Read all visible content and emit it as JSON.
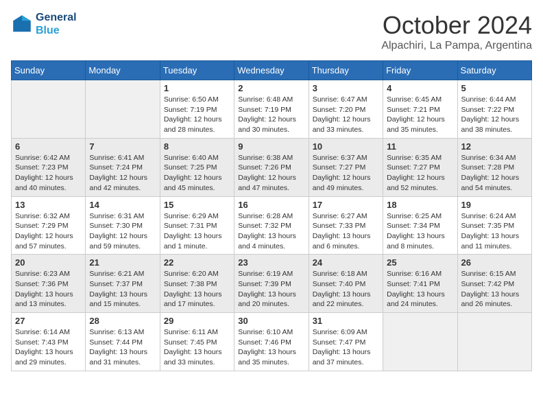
{
  "header": {
    "logo_line1": "General",
    "logo_line2": "Blue",
    "month_title": "October 2024",
    "location": "Alpachiri, La Pampa, Argentina"
  },
  "weekdays": [
    "Sunday",
    "Monday",
    "Tuesday",
    "Wednesday",
    "Thursday",
    "Friday",
    "Saturday"
  ],
  "weeks": [
    [
      {
        "day": "",
        "info": ""
      },
      {
        "day": "",
        "info": ""
      },
      {
        "day": "1",
        "info": "Sunrise: 6:50 AM\nSunset: 7:19 PM\nDaylight: 12 hours and 28 minutes."
      },
      {
        "day": "2",
        "info": "Sunrise: 6:48 AM\nSunset: 7:19 PM\nDaylight: 12 hours and 30 minutes."
      },
      {
        "day": "3",
        "info": "Sunrise: 6:47 AM\nSunset: 7:20 PM\nDaylight: 12 hours and 33 minutes."
      },
      {
        "day": "4",
        "info": "Sunrise: 6:45 AM\nSunset: 7:21 PM\nDaylight: 12 hours and 35 minutes."
      },
      {
        "day": "5",
        "info": "Sunrise: 6:44 AM\nSunset: 7:22 PM\nDaylight: 12 hours and 38 minutes."
      }
    ],
    [
      {
        "day": "6",
        "info": "Sunrise: 6:42 AM\nSunset: 7:23 PM\nDaylight: 12 hours and 40 minutes."
      },
      {
        "day": "7",
        "info": "Sunrise: 6:41 AM\nSunset: 7:24 PM\nDaylight: 12 hours and 42 minutes."
      },
      {
        "day": "8",
        "info": "Sunrise: 6:40 AM\nSunset: 7:25 PM\nDaylight: 12 hours and 45 minutes."
      },
      {
        "day": "9",
        "info": "Sunrise: 6:38 AM\nSunset: 7:26 PM\nDaylight: 12 hours and 47 minutes."
      },
      {
        "day": "10",
        "info": "Sunrise: 6:37 AM\nSunset: 7:27 PM\nDaylight: 12 hours and 49 minutes."
      },
      {
        "day": "11",
        "info": "Sunrise: 6:35 AM\nSunset: 7:27 PM\nDaylight: 12 hours and 52 minutes."
      },
      {
        "day": "12",
        "info": "Sunrise: 6:34 AM\nSunset: 7:28 PM\nDaylight: 12 hours and 54 minutes."
      }
    ],
    [
      {
        "day": "13",
        "info": "Sunrise: 6:32 AM\nSunset: 7:29 PM\nDaylight: 12 hours and 57 minutes."
      },
      {
        "day": "14",
        "info": "Sunrise: 6:31 AM\nSunset: 7:30 PM\nDaylight: 12 hours and 59 minutes."
      },
      {
        "day": "15",
        "info": "Sunrise: 6:29 AM\nSunset: 7:31 PM\nDaylight: 13 hours and 1 minute."
      },
      {
        "day": "16",
        "info": "Sunrise: 6:28 AM\nSunset: 7:32 PM\nDaylight: 13 hours and 4 minutes."
      },
      {
        "day": "17",
        "info": "Sunrise: 6:27 AM\nSunset: 7:33 PM\nDaylight: 13 hours and 6 minutes."
      },
      {
        "day": "18",
        "info": "Sunrise: 6:25 AM\nSunset: 7:34 PM\nDaylight: 13 hours and 8 minutes."
      },
      {
        "day": "19",
        "info": "Sunrise: 6:24 AM\nSunset: 7:35 PM\nDaylight: 13 hours and 11 minutes."
      }
    ],
    [
      {
        "day": "20",
        "info": "Sunrise: 6:23 AM\nSunset: 7:36 PM\nDaylight: 13 hours and 13 minutes."
      },
      {
        "day": "21",
        "info": "Sunrise: 6:21 AM\nSunset: 7:37 PM\nDaylight: 13 hours and 15 minutes."
      },
      {
        "day": "22",
        "info": "Sunrise: 6:20 AM\nSunset: 7:38 PM\nDaylight: 13 hours and 17 minutes."
      },
      {
        "day": "23",
        "info": "Sunrise: 6:19 AM\nSunset: 7:39 PM\nDaylight: 13 hours and 20 minutes."
      },
      {
        "day": "24",
        "info": "Sunrise: 6:18 AM\nSunset: 7:40 PM\nDaylight: 13 hours and 22 minutes."
      },
      {
        "day": "25",
        "info": "Sunrise: 6:16 AM\nSunset: 7:41 PM\nDaylight: 13 hours and 24 minutes."
      },
      {
        "day": "26",
        "info": "Sunrise: 6:15 AM\nSunset: 7:42 PM\nDaylight: 13 hours and 26 minutes."
      }
    ],
    [
      {
        "day": "27",
        "info": "Sunrise: 6:14 AM\nSunset: 7:43 PM\nDaylight: 13 hours and 29 minutes."
      },
      {
        "day": "28",
        "info": "Sunrise: 6:13 AM\nSunset: 7:44 PM\nDaylight: 13 hours and 31 minutes."
      },
      {
        "day": "29",
        "info": "Sunrise: 6:11 AM\nSunset: 7:45 PM\nDaylight: 13 hours and 33 minutes."
      },
      {
        "day": "30",
        "info": "Sunrise: 6:10 AM\nSunset: 7:46 PM\nDaylight: 13 hours and 35 minutes."
      },
      {
        "day": "31",
        "info": "Sunrise: 6:09 AM\nSunset: 7:47 PM\nDaylight: 13 hours and 37 minutes."
      },
      {
        "day": "",
        "info": ""
      },
      {
        "day": "",
        "info": ""
      }
    ]
  ]
}
